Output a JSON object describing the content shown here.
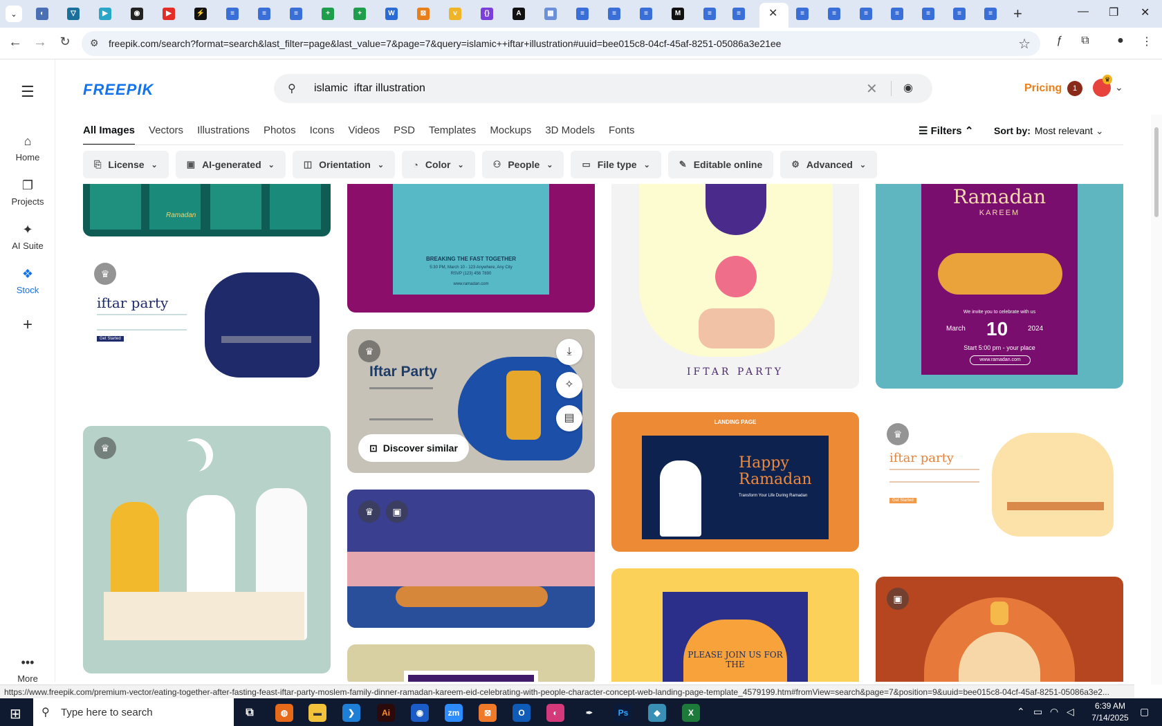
{
  "browser": {
    "url": "freepik.com/search?format=search&last_filter=page&last_value=7&page=7&query=islamic++iftar+illustration#uuid=bee015c8-04cf-45af-8251-05086a3e21ee",
    "status_url": "https://www.freepik.com/premium-vector/eating-together-after-fasting-feast-iftar-party-moslem-family-dinner-ramadan-kareem-eid-celebrating-with-people-character-concept-web-landing-page-template_4579199.htm#fromView=search&page=7&position=9&uuid=bee015c8-04cf-45af-8251-05086a3e2..."
  },
  "brand": {
    "logo": "FREEPIK",
    "accent": "#1273eb",
    "orange": "#e87f1a"
  },
  "sidebar": {
    "items": [
      {
        "label": "Home",
        "icon": "home-icon"
      },
      {
        "label": "Projects",
        "icon": "projects-icon"
      },
      {
        "label": "AI Suite",
        "icon": "sparkle-icon"
      },
      {
        "label": "Stock",
        "icon": "stock-icon"
      },
      {
        "label": "More",
        "icon": "more-icon"
      }
    ]
  },
  "search": {
    "query": "islamic  iftar illustration"
  },
  "header": {
    "pricing": "Pricing",
    "notifications": "1"
  },
  "tabs": [
    "All Images",
    "Vectors",
    "Illustrations",
    "Photos",
    "Icons",
    "Videos",
    "PSD",
    "Templates",
    "Mockups",
    "3D Models",
    "Fonts"
  ],
  "sort": {
    "filters_label": "Filters",
    "label": "Sort by:",
    "value": "Most relevant"
  },
  "filters": [
    "License",
    "AI-generated",
    "Orientation",
    "Color",
    "People",
    "File type",
    "Editable online",
    "Advanced"
  ],
  "cards": {
    "iftar_party_web": {
      "title": "iftar party",
      "cta": "Get Started"
    },
    "breaking_fast": {
      "title": "BREAKING THE FAST TOGETHER",
      "line1": "5:30 PM, March 10 - 123 Anywhere, Any City",
      "line2": "RSVP (123) 456 7890",
      "site": "www.ramadan.com"
    },
    "iftar_party_card": {
      "title": "Iftar Party",
      "discover": "Discover similar"
    },
    "iftar_poster": {
      "title": "IFTAR PARTY"
    },
    "ramadan_kareem": {
      "title": "Ramadan",
      "subtitle": "KAREEM",
      "invite": "We invite you to celebrate with us",
      "month": "March",
      "day": "10",
      "year": "2024",
      "time": "Start 5:00 pm - your place",
      "site": "www.ramadan.com"
    },
    "landing_page": {
      "badge": "LANDING PAGE",
      "title": "Happy Ramadan",
      "tagline": "Transform Your Life During Ramadan"
    },
    "iftar_party_web2": {
      "title": "iftar party",
      "cta": "Get Started"
    },
    "please_join": {
      "title": "PLEASE JOIN US FOR THE"
    },
    "ramadan_top_left": {
      "title": "Ramadan"
    }
  },
  "taskbar": {
    "search_placeholder": "Type here to search",
    "time": "6:39 AM",
    "date": "7/14/2025"
  }
}
